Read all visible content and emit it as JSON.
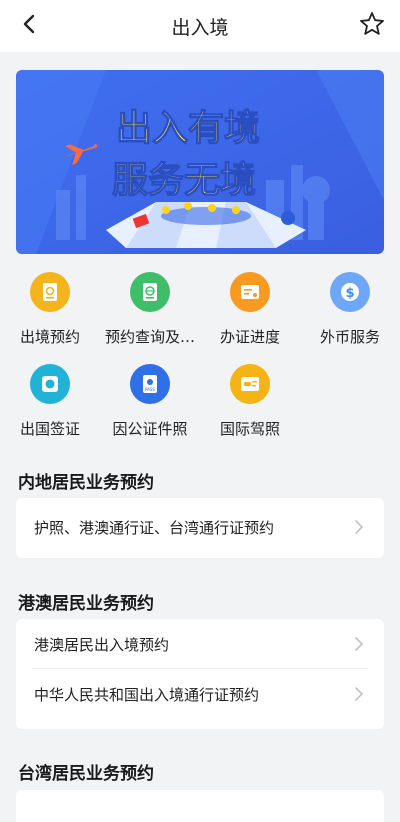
{
  "header": {
    "title": "出入境"
  },
  "banner": {
    "line1": "出入有境",
    "line2": "服务无境"
  },
  "services": [
    {
      "label": "出境预约",
      "color": "#f4b41c",
      "icon": "passport-icon"
    },
    {
      "label": "预约查询及…",
      "color": "#3fbe6a",
      "icon": "passport-globe-icon"
    },
    {
      "label": "办证进度",
      "color": "#f79a1f",
      "icon": "progress-card-icon"
    },
    {
      "label": "外币服务",
      "color": "#3b8ef5",
      "icon": "dollar-icon"
    },
    {
      "label": "出国签证",
      "color": "#20b3d5",
      "icon": "visa-icon"
    },
    {
      "label": "因公证件照",
      "color": "#2f6fe8",
      "icon": "official-passport-icon"
    },
    {
      "label": "国际驾照",
      "color": "#f6b316",
      "icon": "driver-license-icon"
    }
  ],
  "sections": [
    {
      "title": "内地居民业务预约",
      "items": [
        "护照、港澳通行证、台湾通行证预约"
      ]
    },
    {
      "title": "港澳居民业务预约",
      "items": [
        "港澳居民出入境预约",
        "中华人民共和国出入境通行证预约"
      ]
    },
    {
      "title": "台湾居民业务预约",
      "items": []
    }
  ]
}
